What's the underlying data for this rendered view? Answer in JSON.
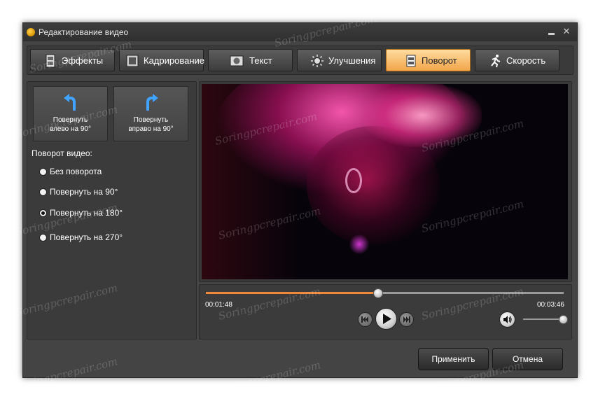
{
  "window": {
    "title": "Редактирование видео",
    "title_icon": "app-icon",
    "minimize_icon": "minimize-icon",
    "close_label": "✕"
  },
  "tabs": [
    {
      "label": "Эффекты",
      "icon": "film-icon",
      "active": false
    },
    {
      "label": "Кадрирование",
      "icon": "crop-icon",
      "active": false
    },
    {
      "label": "Текст",
      "icon": "text-icon",
      "active": false
    },
    {
      "label": "Улучшения",
      "icon": "sun-icon",
      "active": false
    },
    {
      "label": "Поворот",
      "icon": "rotate-icon",
      "active": true
    },
    {
      "label": "Скорость",
      "icon": "runner-icon",
      "active": false
    }
  ],
  "rotate_buttons": {
    "left": {
      "line1": "Повернуть",
      "line2": "влево  на 90°"
    },
    "right": {
      "line1": "Повернуть",
      "line2": "вправо на 90°"
    }
  },
  "rotation": {
    "title": "Поворот видео:",
    "options": [
      {
        "label": "Без поворота",
        "checked": false
      },
      {
        "label": "Повернуть на 90°",
        "checked": false
      },
      {
        "label": "Повернуть на 180°",
        "checked": true
      },
      {
        "label": "Повернуть на 270°",
        "checked": false
      }
    ]
  },
  "player": {
    "current_time": "00:01:48",
    "total_time": "00:03:46",
    "progress": 0.48,
    "volume": 1.0
  },
  "actions": {
    "apply": "Применить",
    "cancel": "Отмена"
  },
  "watermark": "Soringpcrepair.com",
  "colors": {
    "accent": "#f0883a",
    "active_tab": "#f7b868",
    "background": "#444444"
  }
}
